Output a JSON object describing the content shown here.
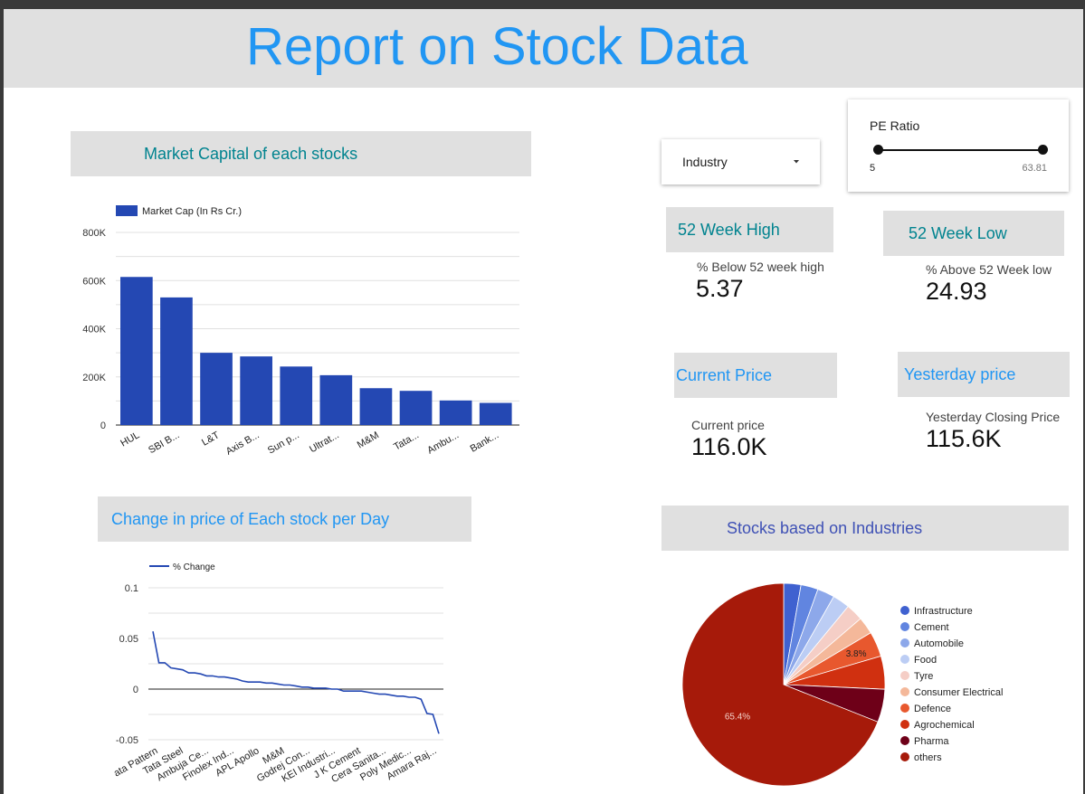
{
  "report": {
    "title": "Report on Stock Data"
  },
  "market_cap": {
    "title": "Market Capital of each stocks",
    "legend": "Market Cap (In Rs Cr.)",
    "color": "#2448b3"
  },
  "price_change": {
    "title": "Change in price of Each stock per Day",
    "legend": "% Change",
    "color": "#2448b3"
  },
  "industry_filter": {
    "label": "Industry"
  },
  "pe_ratio": {
    "label": "PE Ratio",
    "min": "5",
    "max": "63.81"
  },
  "week_high": {
    "title": "52 Week High",
    "label": "% Below 52 week high",
    "value": "5.37"
  },
  "week_low": {
    "title": "52 Week Low",
    "label": "% Above 52 Week low",
    "value": "24.93"
  },
  "current_price": {
    "title": "Current Price",
    "label": "Current price",
    "value": "116.0K"
  },
  "yesterday_price": {
    "title": "Yesterday price",
    "label": "Yesterday Closing Price",
    "value": "115.6K"
  },
  "industries": {
    "title": "Stocks based on Industries"
  },
  "chart_data": [
    {
      "type": "bar",
      "title": "Market Capital of each stocks",
      "categories": [
        "HUL",
        "SBI B...",
        "L&T",
        "Axis B...",
        "Sun p...",
        "Ultrat...",
        "M&M",
        "Tata...",
        "Ambu...",
        "Bank..."
      ],
      "series": [
        {
          "name": "Market Cap (In Rs Cr.)",
          "values": [
            615000,
            530000,
            300000,
            285000,
            243000,
            207000,
            153000,
            142000,
            102000,
            92000
          ]
        }
      ],
      "yticks": [
        "0",
        "200K",
        "400K",
        "600K",
        "800K"
      ],
      "ylim": [
        0,
        800000
      ],
      "grid": true,
      "legend": "top-left"
    },
    {
      "type": "line",
      "title": "Change in price of Each stock per Day",
      "xtick_labels": [
        "ata Pattern",
        "Tata Steel",
        "Ambuja Ce...",
        "Finolex Ind...",
        "APL Apollo",
        "M&M",
        "Godrej Con...",
        "KEI Industri...",
        "J K Cement",
        "Cera Sanita...",
        "Poly Medic...",
        "Amara Raj..."
      ],
      "series": [
        {
          "name": "% Change",
          "values": [
            0.057,
            0.026,
            0.026,
            0.021,
            0.02,
            0.019,
            0.016,
            0.016,
            0.015,
            0.013,
            0.013,
            0.012,
            0.012,
            0.011,
            0.01,
            0.008,
            0.007,
            0.007,
            0.007,
            0.006,
            0.006,
            0.005,
            0.004,
            0.004,
            0.003,
            0.002,
            0.002,
            0.001,
            0.001,
            0.001,
            0.0,
            0.0,
            -0.002,
            -0.002,
            -0.002,
            -0.002,
            -0.003,
            -0.004,
            -0.005,
            -0.005,
            -0.006,
            -0.007,
            -0.007,
            -0.008,
            -0.008,
            -0.01,
            -0.024,
            -0.025,
            -0.044
          ]
        }
      ],
      "yticks": [
        "0.1",
        "0.05",
        "0",
        "-0.05"
      ],
      "ylim": [
        -0.05,
        0.1
      ],
      "grid": true,
      "legend": "top-left"
    },
    {
      "type": "pie",
      "title": "Stocks based on Industries",
      "slices": [
        {
          "label": "Infrastructure",
          "value": 2.6,
          "color": "#3f61d0"
        },
        {
          "label": "Cement",
          "value": 2.6,
          "color": "#6185e0"
        },
        {
          "label": "Automobile",
          "value": 2.6,
          "color": "#8da8ea"
        },
        {
          "label": "Food",
          "value": 2.6,
          "color": "#bccdf4"
        },
        {
          "label": "Tyre",
          "value": 2.6,
          "color": "#f5cec6"
        },
        {
          "label": "Consumer Electrical",
          "value": 2.6,
          "color": "#f4b89a"
        },
        {
          "label": "Defence",
          "value": 3.8,
          "color": "#e8582e",
          "data_label": "3.8%"
        },
        {
          "label": "Agrochemical",
          "value": 5.0,
          "color": "#d03010"
        },
        {
          "label": "Pharma",
          "value": 5.0,
          "color": "#6e0018"
        },
        {
          "label": "others",
          "value": 65.4,
          "color": "#a61a0a",
          "data_label": "65.4%"
        }
      ],
      "legend": "right"
    }
  ]
}
